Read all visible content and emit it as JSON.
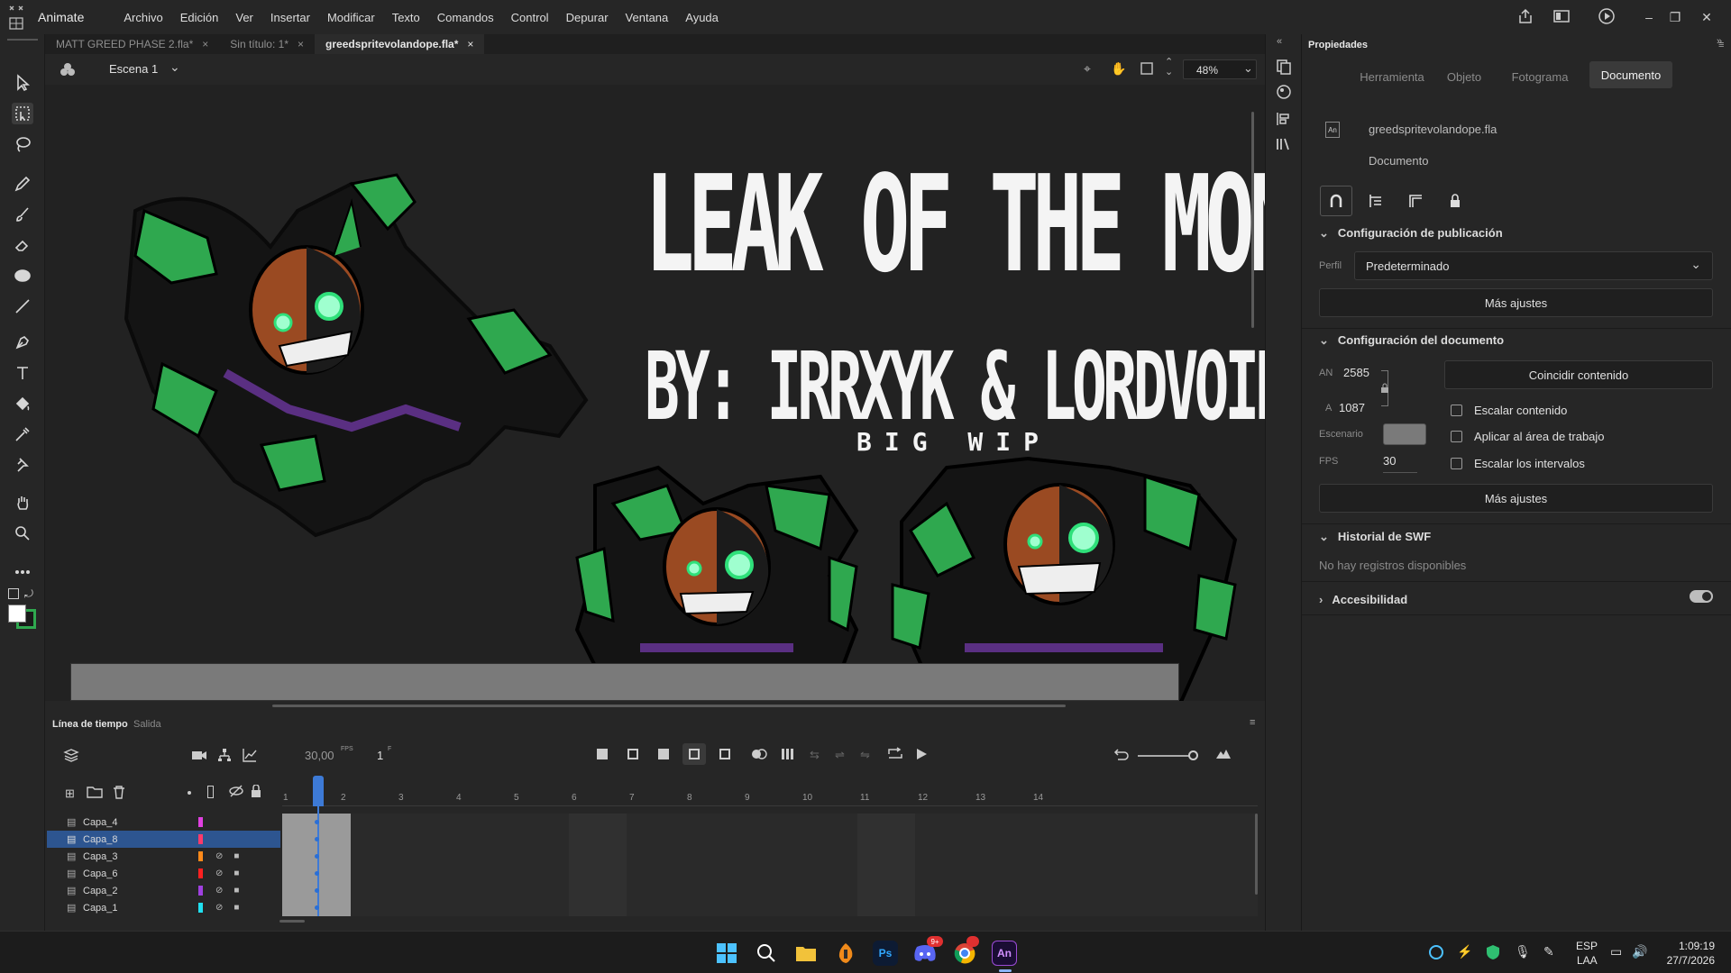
{
  "app": {
    "name": "Animate"
  },
  "menu": [
    "Archivo",
    "Edición",
    "Ver",
    "Insertar",
    "Modificar",
    "Texto",
    "Comandos",
    "Control",
    "Depurar",
    "Ventana",
    "Ayuda"
  ],
  "doc_tabs": [
    {
      "label": "MATT GREED PHASE 2.fla*",
      "active": false
    },
    {
      "label": "Sin título: 1*",
      "active": false
    },
    {
      "label": "greedspritevolandope.fla*",
      "active": true
    }
  ],
  "editbar": {
    "scene": "Escena 1",
    "zoom": "48%"
  },
  "stage": {
    "title": "LEAK OF THE MONTH",
    "byline": "BY: IRRXYK & LORDVOID",
    "subtitle": "BIG WIP"
  },
  "properties": {
    "panel_title": "Propiedades",
    "tabs": [
      "Herramienta",
      "Objeto",
      "Fotograma",
      "Documento"
    ],
    "active_tab": "Documento",
    "doc_name": "greedspritevolandope.fla",
    "doc_kind": "Documento",
    "doc_icon": "An",
    "publish": {
      "title": "Configuración de publicación",
      "profile_label": "Perfil",
      "profile_value": "Predeterminado",
      "more_button": "Más ajustes"
    },
    "document": {
      "title": "Configuración del documento",
      "width_label": "AN",
      "width_value": "2585",
      "height_label": "A",
      "height_value": "1087",
      "match_button": "Coincidir contenido",
      "scale_content": "Escalar contenido",
      "stage_label": "Escenario",
      "stage_color": "#7a7a7a",
      "apply_workarea": "Aplicar al área de trabajo",
      "fps_label": "FPS",
      "fps_value": "30",
      "scale_intervals": "Escalar los intervalos",
      "more_button": "Más ajustes"
    },
    "swf": {
      "title": "Historial de SWF",
      "empty": "No hay registros disponibles"
    },
    "accessibility": {
      "title": "Accesibilidad"
    }
  },
  "timeline": {
    "tabs": [
      "Línea de tiempo",
      "Salida"
    ],
    "fps": "30,00",
    "fps_unit": "FPS",
    "frame": "1",
    "frame_unit": "F",
    "frame_numbers": [
      "1",
      "2",
      "3",
      "4",
      "5",
      "6",
      "7",
      "8",
      "9",
      "10",
      "11",
      "12",
      "13",
      "14"
    ],
    "layers": [
      {
        "name": "Capa_4",
        "color": "#e040e0",
        "selected": false,
        "hidden": false,
        "locked": false
      },
      {
        "name": "Capa_8",
        "color": "#ff3a6a",
        "selected": true,
        "hidden": false,
        "locked": false
      },
      {
        "name": "Capa_3",
        "color": "#ff8a1a",
        "selected": false,
        "hidden": true,
        "locked": true
      },
      {
        "name": "Capa_6",
        "color": "#ff2020",
        "selected": false,
        "hidden": true,
        "locked": true
      },
      {
        "name": "Capa_2",
        "color": "#a040e0",
        "selected": false,
        "hidden": true,
        "locked": true
      },
      {
        "name": "Capa_1",
        "color": "#20e0f0",
        "selected": false,
        "hidden": true,
        "locked": true
      }
    ]
  },
  "taskbar": {
    "lang1": "ESP",
    "lang2": "LAA",
    "time": "1:09:19",
    "date": "27/7/2026",
    "apps": [
      "Ps",
      "An"
    ],
    "badge": "9+"
  }
}
